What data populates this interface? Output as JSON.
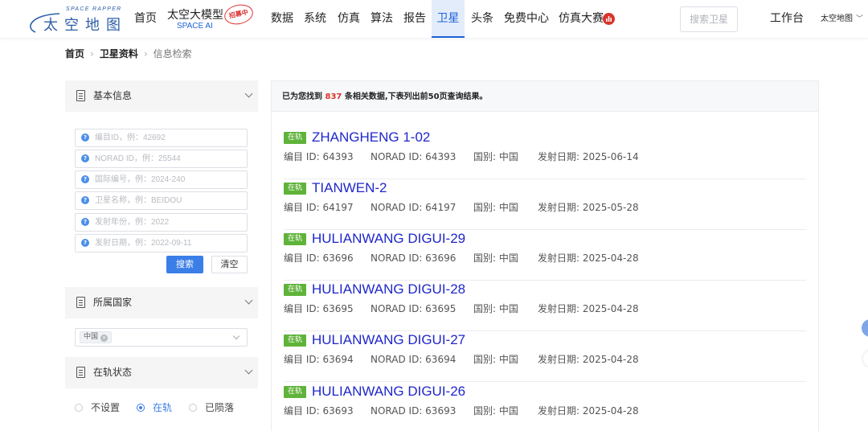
{
  "brand": {
    "tagline": "SPACE RAPPER",
    "name_cn": "太空地图"
  },
  "nav": {
    "home": "首页",
    "ai_title": "太空大模型",
    "ai_sub": "SPACE AI",
    "ai_badge": "招募中",
    "items": [
      "数据",
      "系统",
      "仿真",
      "算法",
      "报告",
      "卫星",
      "头条",
      "免费中心",
      "仿真大赛"
    ],
    "active": "卫星",
    "search_placeholder": "搜索卫星",
    "workbench": "工作台",
    "user": "太空地图"
  },
  "breadcrumb": {
    "home": "首页",
    "section": "卫星资料",
    "current": "信息检索"
  },
  "sidebar": {
    "basic_info": {
      "title": "基本信息",
      "fields": [
        {
          "placeholder": "编目ID，例：42692",
          "value": ""
        },
        {
          "placeholder": "NORAD ID，例：25544",
          "value": ""
        },
        {
          "placeholder": "国际编号，例：2024-240",
          "value": ""
        },
        {
          "placeholder": "卫星名称，例：BEIDOU",
          "value": ""
        },
        {
          "placeholder": "发射年份，例：2022",
          "value": ""
        },
        {
          "placeholder": "发射日期，例：2022-09-11",
          "value": ""
        }
      ],
      "search_button": "搜索",
      "clear_button": "清空"
    },
    "country": {
      "title": "所属国家",
      "selected": "中国"
    },
    "orbit_status": {
      "title": "在轨状态",
      "options": [
        "不设置",
        "在轨",
        "已陨落"
      ],
      "selected": "在轨"
    }
  },
  "results": {
    "summary_prefix": "已为您找到 ",
    "count": "837",
    "summary_suffix": " 条相关数据,下表列出前50页查询结果。",
    "items": [
      {
        "status": "在轨",
        "name": "ZHANGHENG 1-02",
        "catalog": "编目 ID: 64393",
        "norad": "NORAD ID: 64393",
        "country": "国别: 中国",
        "launch": "发射日期: 2025-06-14"
      },
      {
        "status": "在轨",
        "name": "TIANWEN-2",
        "catalog": "编目 ID: 64197",
        "norad": "NORAD ID: 64197",
        "country": "国别: 中国",
        "launch": "发射日期: 2025-05-28"
      },
      {
        "status": "在轨",
        "name": "HULIANWANG DIGUI-29",
        "catalog": "编目 ID: 63696",
        "norad": "NORAD ID: 63696",
        "country": "国别: 中国",
        "launch": "发射日期: 2025-04-28"
      },
      {
        "status": "在轨",
        "name": "HULIANWANG DIGUI-28",
        "catalog": "编目 ID: 63695",
        "norad": "NORAD ID: 63695",
        "country": "国别: 中国",
        "launch": "发射日期: 2025-04-28"
      },
      {
        "status": "在轨",
        "name": "HULIANWANG DIGUI-27",
        "catalog": "编目 ID: 63694",
        "norad": "NORAD ID: 63694",
        "country": "国别: 中国",
        "launch": "发射日期: 2025-04-28"
      },
      {
        "status": "在轨",
        "name": "HULIANWANG DIGUI-26",
        "catalog": "编目 ID: 63693",
        "norad": "NORAD ID: 63693",
        "country": "国别: 中国",
        "launch": "发射日期: 2025-04-28"
      }
    ]
  },
  "colors": {
    "accent": "#3a7ee8",
    "link": "#1f27c9",
    "status_green": "#5fb33a",
    "count_red": "#d9342b"
  }
}
